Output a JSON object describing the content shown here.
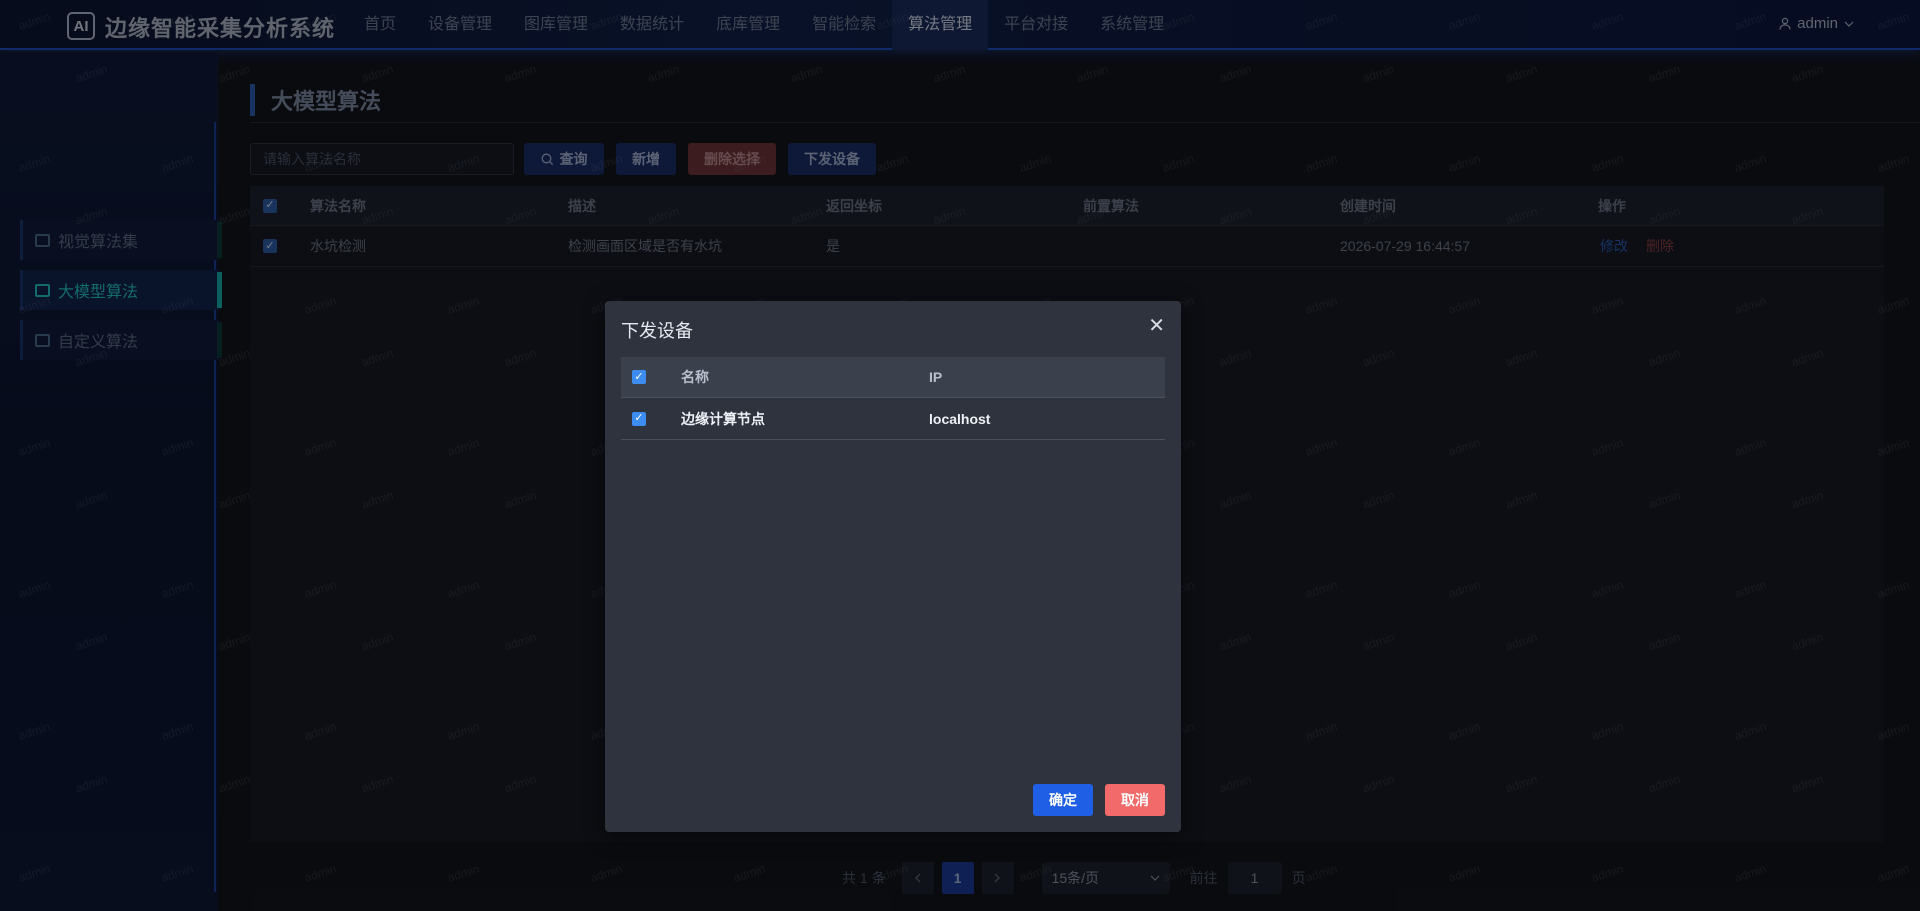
{
  "header": {
    "logo_text": "AI",
    "app_title": "边缘智能采集分析系统",
    "nav": [
      "首页",
      "设备管理",
      "图库管理",
      "数据统计",
      "底库管理",
      "智能检索",
      "算法管理",
      "平台对接",
      "系统管理"
    ],
    "active_nav": "算法管理",
    "user": "admin"
  },
  "sidebar": {
    "items": [
      {
        "label": "视觉算法集"
      },
      {
        "label": "大模型算法",
        "active": true
      },
      {
        "label": "自定义算法"
      }
    ]
  },
  "main": {
    "title": "大模型算法",
    "search_placeholder": "请输入算法名称",
    "buttons": {
      "query": "查询",
      "add": "新增",
      "delete_selected": "删除选择",
      "dispatch": "下发设备"
    },
    "table": {
      "columns": [
        "算法名称",
        "描述",
        "返回坐标",
        "前置算法",
        "创建时间",
        "操作"
      ],
      "rows": [
        {
          "name": "水坑检测",
          "desc": "检测画面区域是否有水坑",
          "return_coord": "是",
          "pre_algo": "",
          "created": "2026-07-29 16:44:57",
          "checked": true
        }
      ],
      "actions": {
        "edit": "修改",
        "delete": "删除"
      }
    },
    "pager": {
      "total_text": "共 1 条",
      "current_page": "1",
      "page_size": "15条/页",
      "goto_label": "前往",
      "goto_value": "1",
      "page_suffix": "页"
    }
  },
  "dialog": {
    "title": "下发设备",
    "columns": [
      "名称",
      "IP"
    ],
    "rows": [
      {
        "name": "边缘计算节点",
        "ip": "localhost",
        "checked": true
      }
    ],
    "ok": "确定",
    "cancel": "取消"
  },
  "watermark": "admin"
}
